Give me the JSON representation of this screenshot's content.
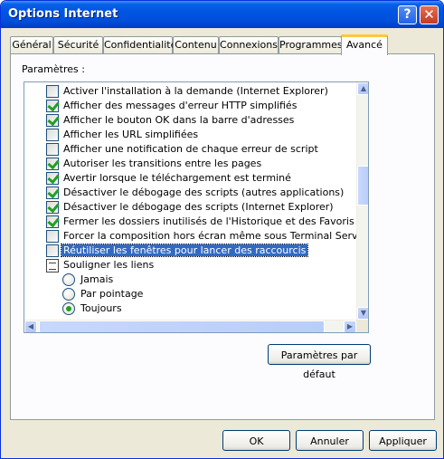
{
  "window": {
    "title": "Options Internet"
  },
  "titlebar": {
    "help_glyph": "?",
    "close_glyph": "✕"
  },
  "tabs": [
    {
      "label": "Général"
    },
    {
      "label": "Sécurité"
    },
    {
      "label": "Confidentialité"
    },
    {
      "label": "Contenu"
    },
    {
      "label": "Connexions"
    },
    {
      "label": "Programmes"
    },
    {
      "label": "Avancé",
      "active": true
    }
  ],
  "settings": {
    "group_label": "Paramètres :",
    "rows": [
      {
        "label": "Activer l'installation à la demande (Internet Explorer)",
        "checked": false
      },
      {
        "label": "Afficher des messages d'erreur HTTP simplifiés",
        "checked": true
      },
      {
        "label": "Afficher le bouton OK dans la barre d'adresses",
        "checked": true
      },
      {
        "label": "Afficher les URL simplifiées",
        "checked": false
      },
      {
        "label": "Afficher une notification de chaque erreur de script",
        "checked": false
      },
      {
        "label": "Autoriser les transitions entre les pages",
        "checked": true
      },
      {
        "label": "Avertir lorsque le téléchargement est terminé",
        "checked": true
      },
      {
        "label": "Désactiver le débogage des scripts (autres applications)",
        "checked": true
      },
      {
        "label": "Désactiver le débogage des scripts (Internet Explorer)",
        "checked": true
      },
      {
        "label": "Fermer les dossiers inutilisés de l'Historique et des Favoris (redémarra",
        "checked": true
      },
      {
        "label": "Forcer la composition hors écran même sous Terminal Server (redém",
        "checked": false
      },
      {
        "label": "Réutiliser les fenêtres pour lancer des raccourcis",
        "checked": false,
        "selected": true
      }
    ],
    "underline_group": {
      "label": "Souligner les liens",
      "icon": "document-icon",
      "options": [
        {
          "label": "Jamais",
          "selected": false
        },
        {
          "label": "Par pointage",
          "selected": false
        },
        {
          "label": "Toujours",
          "selected": true
        }
      ]
    }
  },
  "buttons": {
    "restore_defaults": "Paramètres par défaut",
    "ok": "OK",
    "cancel": "Annuler",
    "apply": "Appliquer"
  },
  "colors": {
    "titlebar": "#0054e3",
    "selection": "#316ac5",
    "check": "#21a121",
    "active_tab_accent": "#ffc83c"
  }
}
